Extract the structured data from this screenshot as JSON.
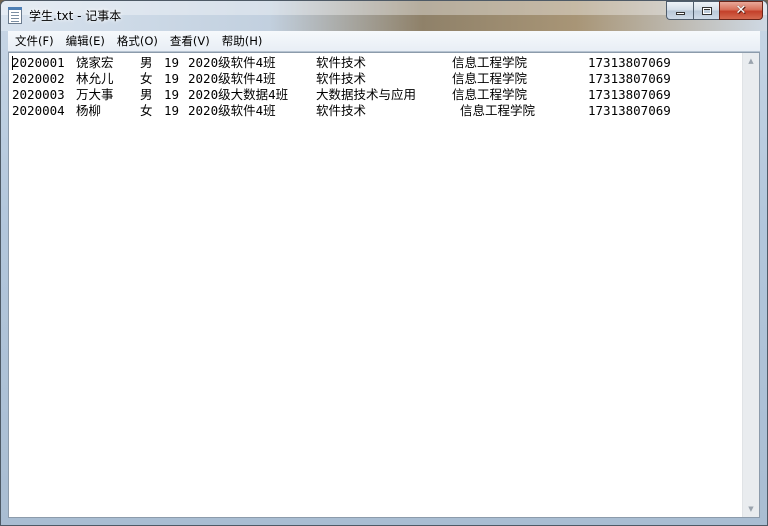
{
  "window": {
    "title": "学生.txt - 记事本",
    "icon": "notepad-icon"
  },
  "caption": {
    "minimize_icon": "minimize-icon",
    "maximize_icon": "maximize-icon",
    "close_glyph": "✕"
  },
  "menu": {
    "items": [
      "文件(F)",
      "编辑(E)",
      "格式(O)",
      "查看(V)",
      "帮助(H)"
    ]
  },
  "document": {
    "rows": [
      [
        "2020001",
        "饶家宏",
        "男",
        "19",
        "2020级软件4班",
        "软件技术",
        "信息工程学院",
        "17313807069"
      ],
      [
        "2020002",
        "林允儿",
        "女",
        "19",
        "2020级软件4班",
        "软件技术",
        "信息工程学院",
        "17313807069"
      ],
      [
        "2020003",
        "万大事",
        "男",
        "19",
        "2020级大数据4班",
        "大数据技术与应用",
        "信息工程学院",
        "17313807069"
      ],
      [
        "2020004",
        "杨柳",
        "女",
        "19",
        "2020级软件4班",
        "软件技术",
        "信息工程学院",
        "17313807069"
      ]
    ]
  },
  "scrollbar": {
    "up_glyph": "▲",
    "down_glyph": "▼"
  }
}
